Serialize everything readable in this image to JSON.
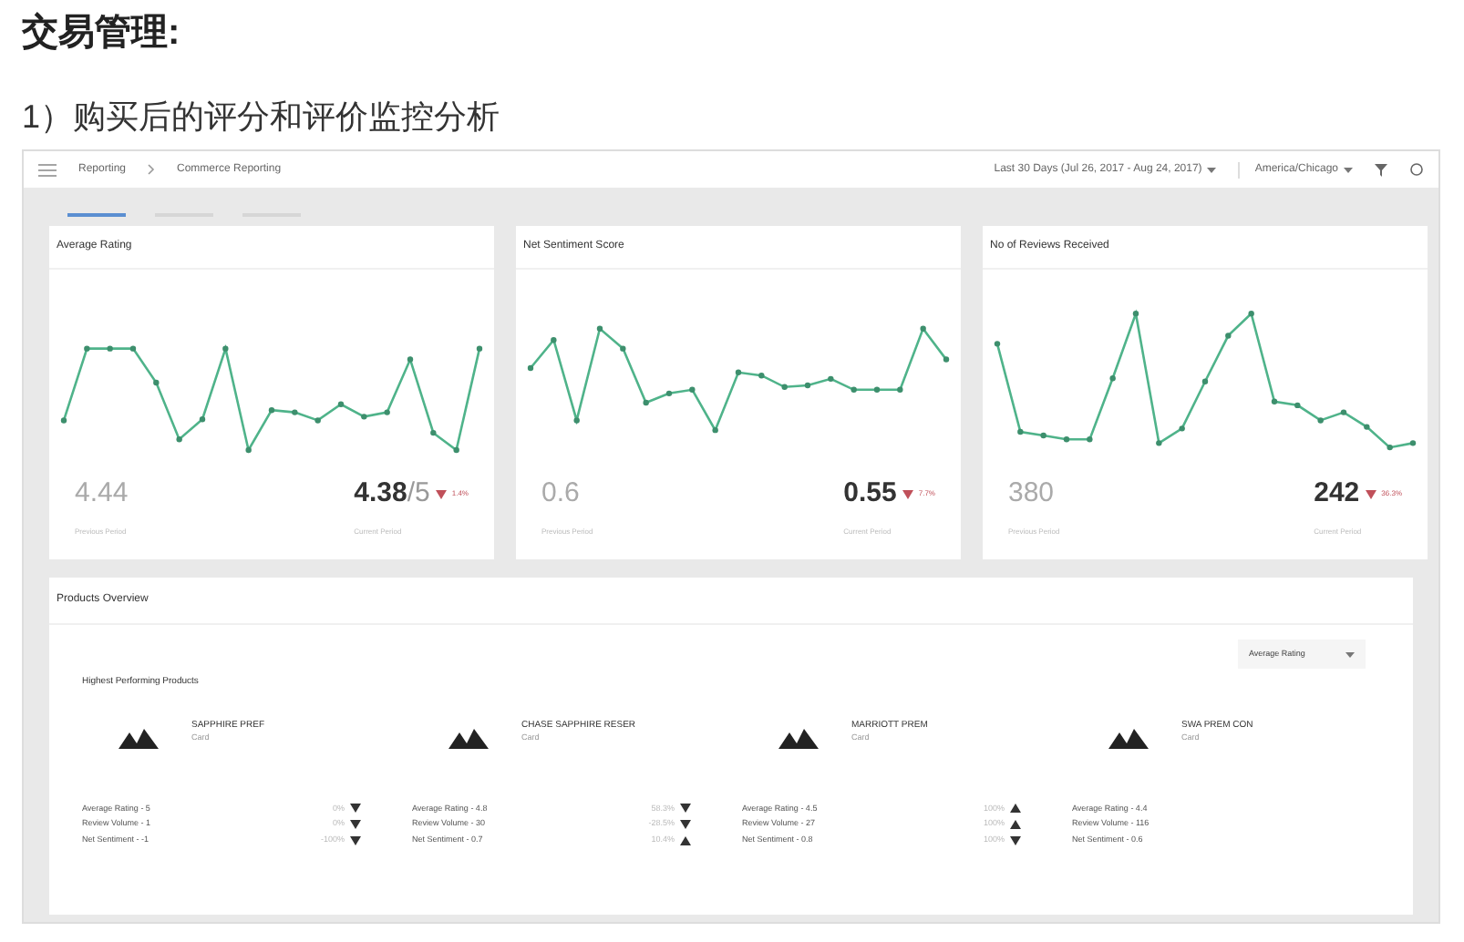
{
  "heading": "交易管理:",
  "subheading": "1）购买后的评分和评价监控分析",
  "header": {
    "breadcrumb": [
      "Reporting",
      "Commerce Reporting"
    ],
    "date_range": "Last 30 Days (Jul 26, 2017 - Aug 24, 2017)",
    "timezone": "America/Chicago"
  },
  "tabs": [
    {
      "selected": true
    },
    {
      "selected": false
    },
    {
      "selected": false
    }
  ],
  "cards": [
    {
      "title": "Average Rating",
      "previous_value": "4.44",
      "previous_label": "Previous Period",
      "current_value": "4.38",
      "current_suffix": "/5",
      "change": "1.4%",
      "up": false,
      "current_label": "Current Period"
    },
    {
      "title": "Net Sentiment Score",
      "previous_value": "0.6",
      "previous_label": "Previous Period",
      "current_value": "0.55",
      "change": "7.7%",
      "up": false,
      "current_label": "Current Period"
    },
    {
      "title": "No of Reviews Received",
      "previous_value": "380",
      "previous_label": "Previous Period",
      "current_value": "242",
      "change": "36.3%",
      "up": false,
      "current_label": "Current Period"
    }
  ],
  "products_overview": {
    "title": "Products Overview",
    "sort_select": "Average Rating",
    "section_title": "Highest Performing Products",
    "products": [
      {
        "name": "SAPPHIRE PREF",
        "type": "Card",
        "metrics": [
          {
            "label": "Average Rating - 5",
            "change": "0%",
            "up": false
          },
          {
            "label": "Review Volume - 1",
            "change": "0%",
            "up": false
          },
          {
            "label": "Net Sentiment - -1",
            "change": "-100%",
            "up": false
          }
        ]
      },
      {
        "name": "CHASE SAPPHIRE RESER",
        "type": "Card",
        "metrics": [
          {
            "label": "Average Rating - 4.8",
            "change": "58.3%",
            "up": false
          },
          {
            "label": "Review Volume - 30",
            "change": "-28.5%",
            "up": false
          },
          {
            "label": "Net Sentiment - 0.7",
            "change": "10.4%",
            "up": true
          }
        ]
      },
      {
        "name": "MARRIOTT PREM",
        "type": "Card",
        "metrics": [
          {
            "label": "Average Rating - 4.5",
            "change": "100%",
            "up": true
          },
          {
            "label": "Review Volume - 27",
            "change": "100%",
            "up": true
          },
          {
            "label": "Net Sentiment - 0.8",
            "change": "100%",
            "up": false
          }
        ]
      },
      {
        "name": "SWA PREM CON",
        "type": "Card",
        "metrics": [
          {
            "label": "Average Rating - 4.4"
          },
          {
            "label": "Review Volume - 116"
          },
          {
            "label": "Net Sentiment - 0.6"
          }
        ]
      }
    ]
  }
}
